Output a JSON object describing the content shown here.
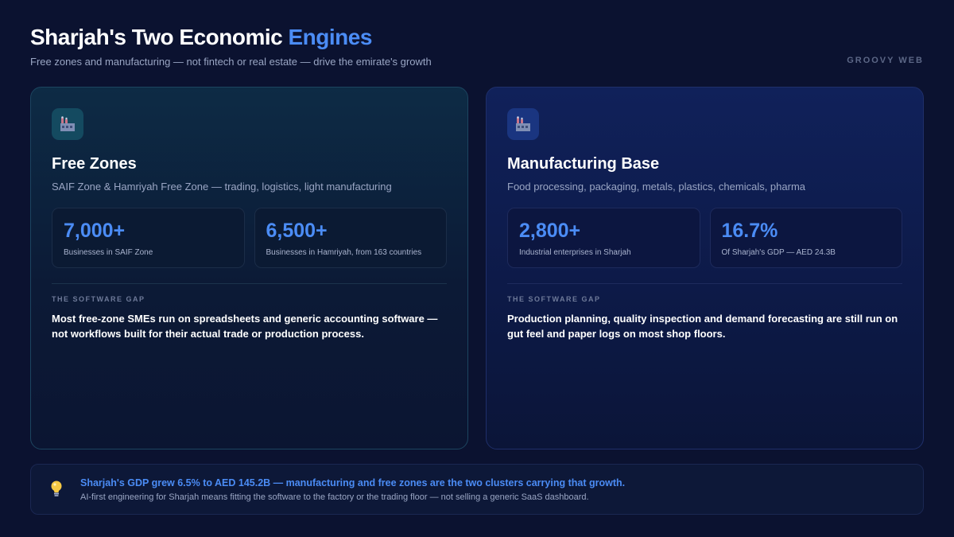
{
  "header": {
    "title_main": "Sharjah's Two Economic ",
    "title_accent": "Engines",
    "subtitle": "Free zones and manufacturing — not fintech or real estate — drive the emirate's growth",
    "brand": "GROOVY WEB"
  },
  "cards": [
    {
      "icon": "factory-icon",
      "title": "Free Zones",
      "description": "SAIF Zone & Hamriyah Free Zone — trading, logistics, light manufacturing",
      "stats": [
        {
          "value": "7,000+",
          "label": "Businesses in SAIF Zone"
        },
        {
          "value": "6,500+",
          "label": "Businesses in Hamriyah, from 163 countries"
        }
      ],
      "gap_label": "THE SOFTWARE GAP",
      "gap_text": "Most free-zone SMEs run on spreadsheets and generic accounting software — not workflows built for their actual trade or production process."
    },
    {
      "icon": "factory-icon",
      "title": "Manufacturing Base",
      "description": "Food processing, packaging, metals, plastics, chemicals, pharma",
      "stats": [
        {
          "value": "2,800+",
          "label": "Industrial enterprises in Sharjah"
        },
        {
          "value": "16.7%",
          "label": "Of Sharjah's GDP — AED 24.3B"
        }
      ],
      "gap_label": "THE SOFTWARE GAP",
      "gap_text": "Production planning, quality inspection and demand forecasting are still run on gut feel and paper logs on most shop floors."
    }
  ],
  "callout": {
    "icon": "lightbulb-icon",
    "main": "Sharjah's GDP grew 6.5% to AED 145.2B — manufacturing and free zones are the two clusters carrying that growth.",
    "sub": "AI-first engineering for Sharjah means fitting the software to the factory or the trading floor — not selling a generic SaaS dashboard."
  },
  "colors": {
    "background": "#0b1230",
    "accent": "#4b8cf5",
    "muted_text": "#9aa6c4"
  }
}
